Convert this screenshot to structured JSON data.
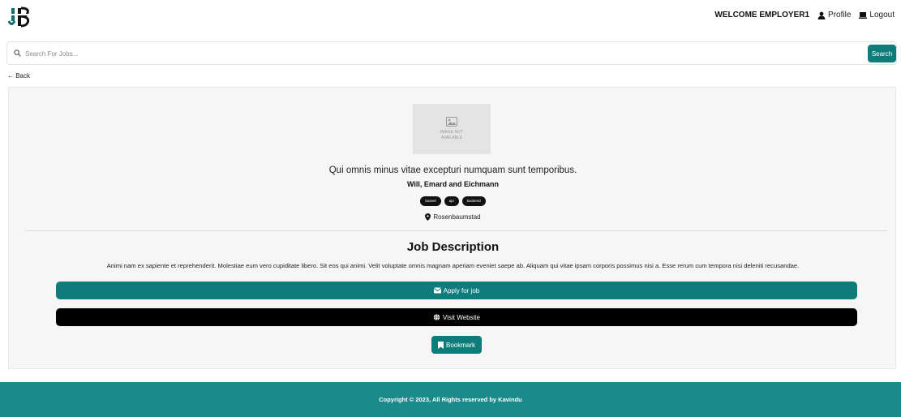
{
  "header": {
    "welcome": "WELCOME EMPLOYER1",
    "profile_label": "Profile",
    "logout_label": "Logout"
  },
  "search": {
    "placeholder": "Search For Jobs...",
    "value": "",
    "button_label": "Search"
  },
  "back_label": "← Back",
  "job": {
    "image_placeholder": "IMAGE NOT AVAILABLE",
    "title": "Qui omnis minus vitae excepturi numquam sunt temporibus.",
    "company": "Will, Emard and Eichmann",
    "tags": [
      "laravel",
      "api",
      "backend"
    ],
    "location": "Rosenbaumstad",
    "description_heading": "Job Description",
    "description": "Animi nam ex sapiente et reprehenderit. Molestiae eum vero cupiditate libero. Sit eos qui animi. Velit voluptate omnis magnam aperiam eveniet saepe ab. Aliquam qui vitae ipsam corporis possimus nisi a. Esse rerum cum tempora nisi deleniti recusandae.",
    "apply_label": "Apply for job",
    "visit_label": "Visit Website",
    "bookmark_label": "Bookmark"
  },
  "footer": {
    "copyright": "Copyright © 2023, All Rights reserved by Kavindu"
  },
  "colors": {
    "primary": "#0f7c7c",
    "footer": "#1b8a8a",
    "dark": "#000000"
  }
}
